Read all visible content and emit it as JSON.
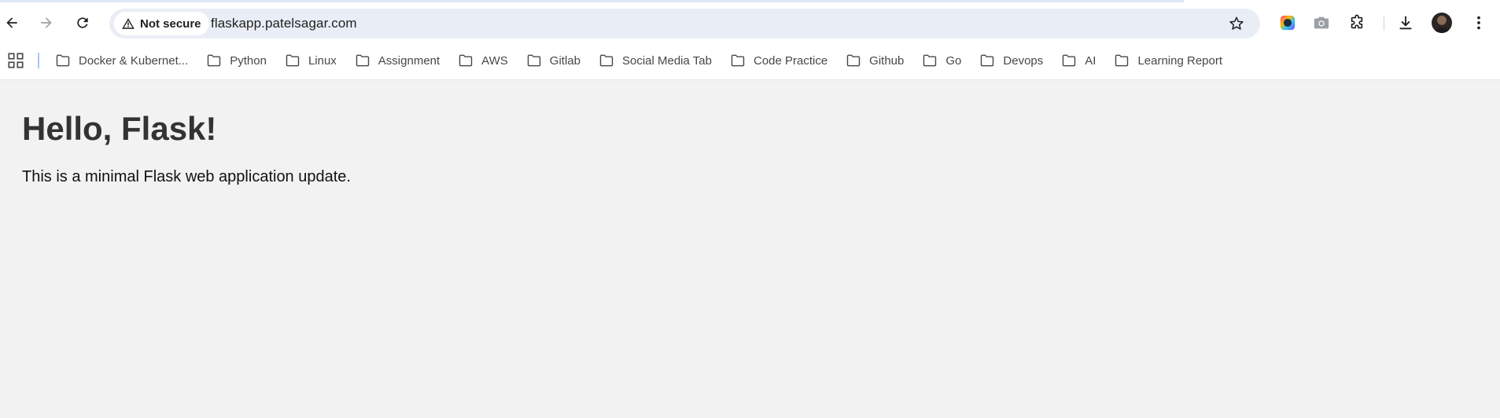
{
  "browser": {
    "url": "flaskapp.patelsagar.com",
    "security_label": "Not secure",
    "bookmarks": [
      {
        "label": "Docker & Kubernet..."
      },
      {
        "label": "Python"
      },
      {
        "label": "Linux"
      },
      {
        "label": "Assignment"
      },
      {
        "label": "AWS"
      },
      {
        "label": "Gitlab"
      },
      {
        "label": "Social Media Tab"
      },
      {
        "label": "Code Practice"
      },
      {
        "label": "Github"
      },
      {
        "label": "Go"
      },
      {
        "label": "Devops"
      },
      {
        "label": "AI"
      },
      {
        "label": "Learning Report"
      }
    ],
    "icons": {
      "back": "arrow-left-icon",
      "forward": "arrow-right-icon",
      "reload": "reload-icon",
      "warning": "warning-triangle-icon",
      "star": "star-icon",
      "color_picker": "color-wheel-icon",
      "screenshot": "camera-icon",
      "extensions": "puzzle-icon",
      "download": "download-icon",
      "menu": "kebab-menu-icon",
      "apps": "apps-grid-icon",
      "folder": "folder-icon"
    },
    "colors": {
      "omnibox_bg": "#e9eef6",
      "page_bg": "#f2f2f2",
      "separator": "#a8c7fa"
    }
  },
  "page": {
    "heading": "Hello, Flask!",
    "text": "This is a minimal Flask web application update."
  }
}
